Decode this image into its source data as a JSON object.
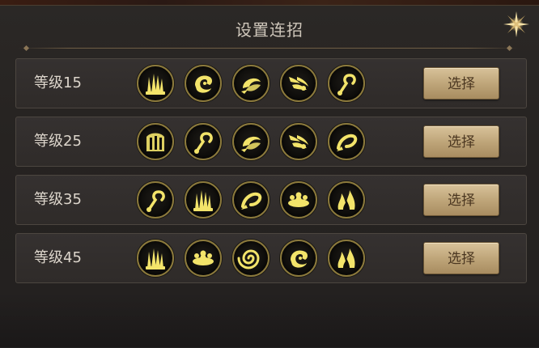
{
  "dialog": {
    "title": "设置连招",
    "close_icon": "close-star-icon"
  },
  "rows": [
    {
      "level_label": "等级15",
      "select_label": "选择",
      "skills": [
        "spikes-burst-icon",
        "dragon-head-icon",
        "shell-strike-icon",
        "flame-dash-icon",
        "hook-strike-icon"
      ]
    },
    {
      "level_label": "等级25",
      "select_label": "选择",
      "skills": [
        "pillar-shield-icon",
        "hook-strike-icon",
        "shell-strike-icon",
        "flame-dash-icon",
        "swirl-slash-icon"
      ]
    },
    {
      "level_label": "等级35",
      "select_label": "选择",
      "skills": [
        "hook-strike-icon",
        "spikes-burst-icon",
        "swirl-slash-icon",
        "ground-shock-icon",
        "fire-burst-icon"
      ]
    },
    {
      "level_label": "等级45",
      "select_label": "选择",
      "skills": [
        "spikes-burst-icon",
        "ground-shock-icon",
        "vortex-icon",
        "dragon-head-icon",
        "fire-burst-icon"
      ]
    }
  ],
  "colors": {
    "icon_glow": "#f3e46a",
    "button_face": "#c9b286",
    "panel_bg": "#262321"
  }
}
